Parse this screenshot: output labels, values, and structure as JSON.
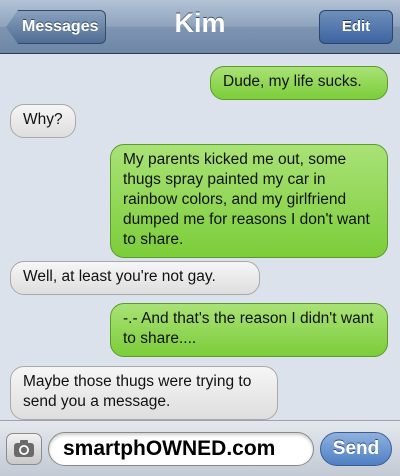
{
  "header": {
    "back_label": "Messages",
    "title": "Kim",
    "edit_label": "Edit"
  },
  "messages": [
    {
      "direction": "sent",
      "text": "Dude, my life sucks."
    },
    {
      "direction": "received",
      "text": "Why?"
    },
    {
      "direction": "sent",
      "text": "My parents kicked me out, some thugs spray painted my car in rainbow colors, and my girlfriend dumped me for reasons I don't want to share."
    },
    {
      "direction": "received",
      "text": "Well, at least you're not gay."
    },
    {
      "direction": "sent",
      "text": "-.- And that's the reason I didn't want to share...."
    },
    {
      "direction": "received",
      "text": "Maybe those thugs were trying to send you a message."
    }
  ],
  "composer": {
    "camera_icon": "camera-icon",
    "input_value": "smartphOWNED.com",
    "send_label": "Send"
  },
  "colors": {
    "sent_bubble": "#7ccd3a",
    "received_bubble": "#e6e6e6",
    "navbar": "#7f95b2",
    "send_button": "#4f80c4"
  }
}
